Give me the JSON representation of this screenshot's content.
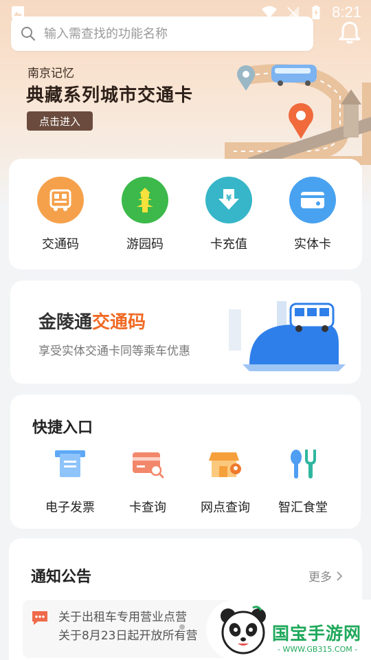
{
  "status_bar": {
    "time": "8:21"
  },
  "search": {
    "placeholder": "输入需查找的功能名称",
    "value": ""
  },
  "banner": {
    "subtitle": "南京记忆",
    "title": "典藏系列城市交通卡",
    "button": "点击进入"
  },
  "functions": [
    {
      "label": "交通码",
      "icon": "bus-code-icon",
      "color": "#f5a14b"
    },
    {
      "label": "游园码",
      "icon": "tower-icon",
      "color": "#3cb94a"
    },
    {
      "label": "卡充值",
      "icon": "yuan-download-icon",
      "color": "#36b6c8"
    },
    {
      "label": "实体卡",
      "icon": "card-icon",
      "color": "#49a2ef"
    }
  ],
  "promo": {
    "title_prefix": "金陵通",
    "title_accent": "交通码",
    "subtitle": "享受实体交通卡同等乘车优惠"
  },
  "quick": {
    "title": "快捷入口",
    "items": [
      {
        "label": "电子发票",
        "icon": "invoice-icon"
      },
      {
        "label": "卡查询",
        "icon": "card-search-icon"
      },
      {
        "label": "网点查询",
        "icon": "store-location-icon"
      },
      {
        "label": "智汇食堂",
        "icon": "canteen-icon"
      }
    ]
  },
  "notices": {
    "title": "通知公告",
    "more": "更多",
    "items": [
      "关于出租车专用营业点营",
      "关于8月23日起开放所有营"
    ]
  },
  "watermark": {
    "brand": "国宝手游网",
    "url": "- WWW.GB315.COM -"
  },
  "colors": {
    "accent": "#f06a25",
    "banner_button": "#6b4b3d",
    "watermark_green": "#1fa85a"
  }
}
